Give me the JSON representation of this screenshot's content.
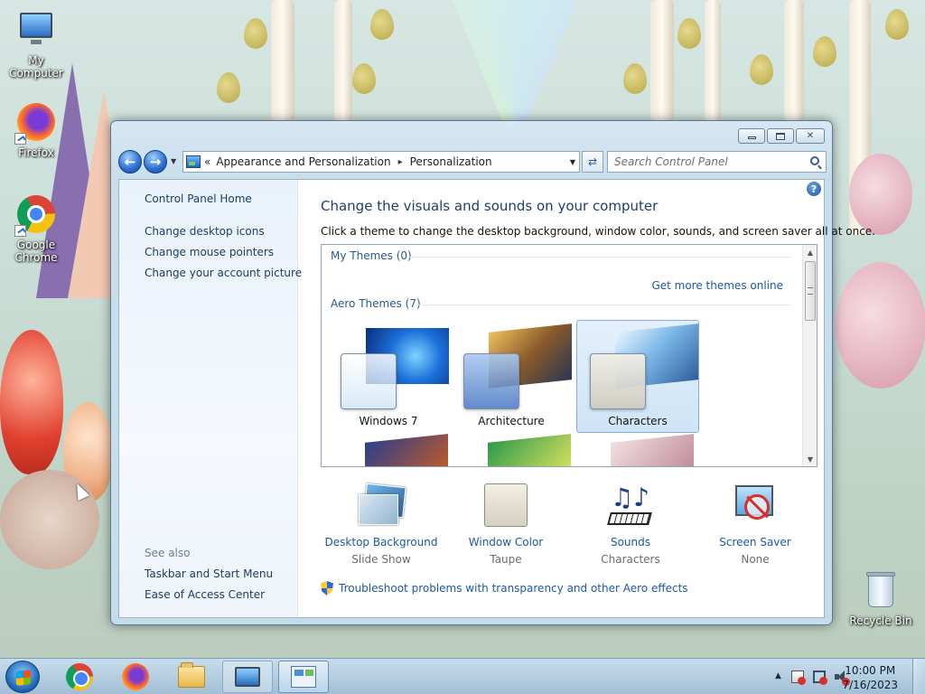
{
  "desktop": {
    "icons": [
      {
        "label": "My Computer"
      },
      {
        "label": "Firefox"
      },
      {
        "label": "Google Chrome"
      },
      {
        "label": "Recycle Bin"
      }
    ]
  },
  "window": {
    "address": {
      "overflow": "«",
      "crumbs": [
        "Appearance and Personalization",
        "Personalization"
      ],
      "separator": "▸"
    },
    "search_placeholder": "Search Control Panel",
    "left_pane": {
      "home": "Control Panel Home",
      "links": [
        "Change desktop icons",
        "Change mouse pointers",
        "Change your account picture"
      ],
      "see_also_label": "See also",
      "see_also": [
        "Taskbar and Start Menu",
        "Ease of Access Center"
      ]
    },
    "main": {
      "title": "Change the visuals and sounds on your computer",
      "description": "Click a theme to change the desktop background, window color, sounds, and screen saver all at once.",
      "my_themes": "My Themes (0)",
      "get_more": "Get more themes online",
      "aero_themes": "Aero Themes (7)",
      "themes": [
        {
          "name": "Windows 7",
          "selected": false
        },
        {
          "name": "Architecture",
          "selected": false
        },
        {
          "name": "Characters",
          "selected": true
        }
      ],
      "bottom": [
        {
          "title": "Desktop Background",
          "value": "Slide Show",
          "icon": "photo-stack-icon"
        },
        {
          "title": "Window Color",
          "value": "Taupe",
          "icon": "color-swatch-icon",
          "color": "#ddd6c8"
        },
        {
          "title": "Sounds",
          "value": "Characters",
          "icon": "music-notes-icon"
        },
        {
          "title": "Screen Saver",
          "value": "None",
          "icon": "screen-saver-icon"
        }
      ],
      "troubleshoot": "Troubleshoot problems with transparency and other Aero effects"
    }
  },
  "taskbar": {
    "items": [
      "start",
      "google-chrome",
      "firefox",
      "windows-explorer",
      "remote-desktop",
      "control-panel"
    ],
    "tray_expand": "▲",
    "time": "10:00 PM",
    "date": "7/16/2023"
  }
}
